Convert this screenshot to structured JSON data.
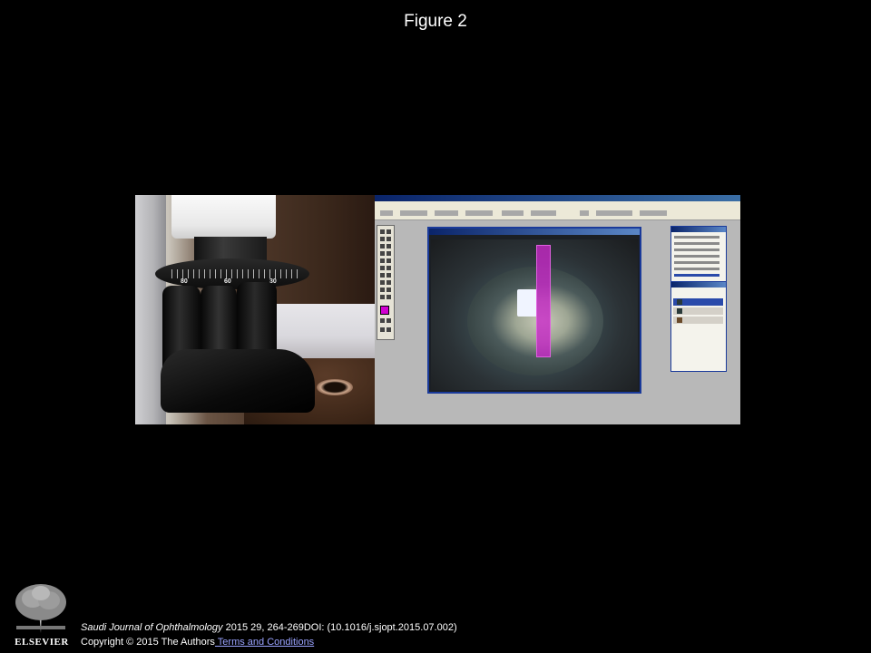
{
  "figure": {
    "title": "Figure 2",
    "left_photo_dial_numbers": [
      "80",
      "60",
      "30"
    ]
  },
  "footer": {
    "journal_name": "Saudi Journal of Ophthalmology",
    "citation_rest": " 2015 29, 264-269DOI: (10.1016/j.sjopt.2015.07.002)",
    "copyright_text": "Copyright © 2015 The Authors",
    "terms_link": " Terms and Conditions",
    "publisher_logo": "ELSEVIER"
  },
  "colors": {
    "background": "#000000",
    "link": "#9aa3ff",
    "slit_band": "#c828c8"
  }
}
